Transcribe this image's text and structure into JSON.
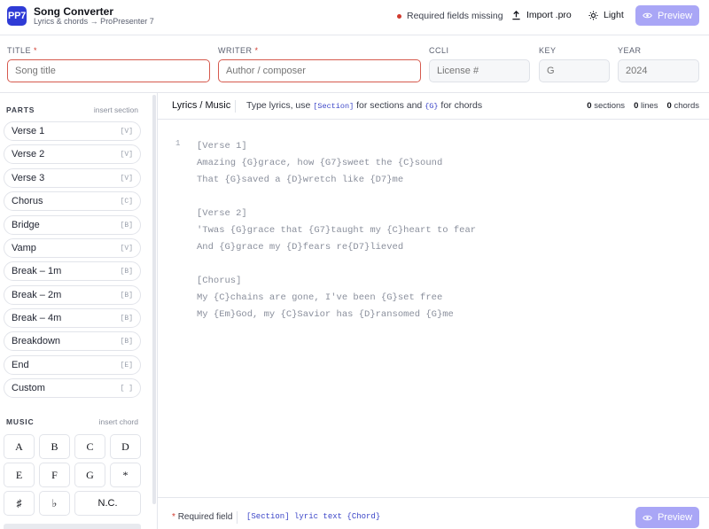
{
  "app": {
    "logo_text": "PP7",
    "title": "Song Converter",
    "subtitle": "Lyrics & chords → ProPresenter 7"
  },
  "header": {
    "status_text": "Required fields missing",
    "import_label": "Import .pro",
    "theme_label": "Light",
    "preview_label": "Preview"
  },
  "fields": {
    "title": {
      "label": "TITLE",
      "placeholder": "Song title",
      "required": "*"
    },
    "writer": {
      "label": "WRITER",
      "placeholder": "Author / composer",
      "required": "*"
    },
    "ccli": {
      "label": "CCLI",
      "placeholder": "License #"
    },
    "key": {
      "label": "KEY",
      "placeholder": "G"
    },
    "year": {
      "label": "YEAR",
      "placeholder": "2024"
    }
  },
  "sidebar": {
    "parts_heading": "PARTS",
    "parts_hint": "insert section",
    "parts": [
      {
        "label": "Verse 1",
        "key": "[V]"
      },
      {
        "label": "Verse 2",
        "key": "[V]"
      },
      {
        "label": "Verse 3",
        "key": "[V]"
      },
      {
        "label": "Chorus",
        "key": "[C]"
      },
      {
        "label": "Bridge",
        "key": "[B]"
      },
      {
        "label": "Vamp",
        "key": "[V]"
      },
      {
        "label": "Break – 1m",
        "key": "[B]"
      },
      {
        "label": "Break – 2m",
        "key": "[B]"
      },
      {
        "label": "Break – 4m",
        "key": "[B]"
      },
      {
        "label": "Breakdown",
        "key": "[B]"
      },
      {
        "label": "End",
        "key": "[E]"
      },
      {
        "label": "Custom",
        "key": "[ ]"
      }
    ],
    "music_heading": "MUSIC",
    "music_hint": "insert chord",
    "keys": [
      "A",
      "B",
      "C",
      "D",
      "E",
      "F",
      "G",
      "*",
      "♯",
      "♭",
      "N.C."
    ]
  },
  "editor": {
    "tab_label": "Lyrics / Music",
    "hint_prefix": "Type lyrics, use",
    "hint_section_code": "[Section]",
    "hint_middle": "for sections and",
    "hint_chord_code": "{G}",
    "hint_suffix": "for chords",
    "stats": {
      "sections": "0",
      "sections_label": "sections",
      "lines": "0",
      "lines_label": "lines",
      "chords": "0",
      "chords_label": "chords"
    },
    "line_number": "1",
    "lyrics": "[Verse 1]\nAmazing {G}grace, how {G7}sweet the {C}sound\nThat {G}saved a {D}wretch like {D7}me\n\n[Verse 2]\n'Twas {G}grace that {G7}taught my {C}heart to fear\nAnd {G}grace my {D}fears re{D7}lieved\n\n[Chorus]\nMy {C}chains are gone, I've been {G}set free\nMy {Em}God, my {C}Savior has {D}ransomed {G}me"
  },
  "footer": {
    "required_star": "*",
    "required_note": "Required field",
    "syntax_hint": "[Section] lyric text {Chord}",
    "preview_label": "Preview"
  }
}
